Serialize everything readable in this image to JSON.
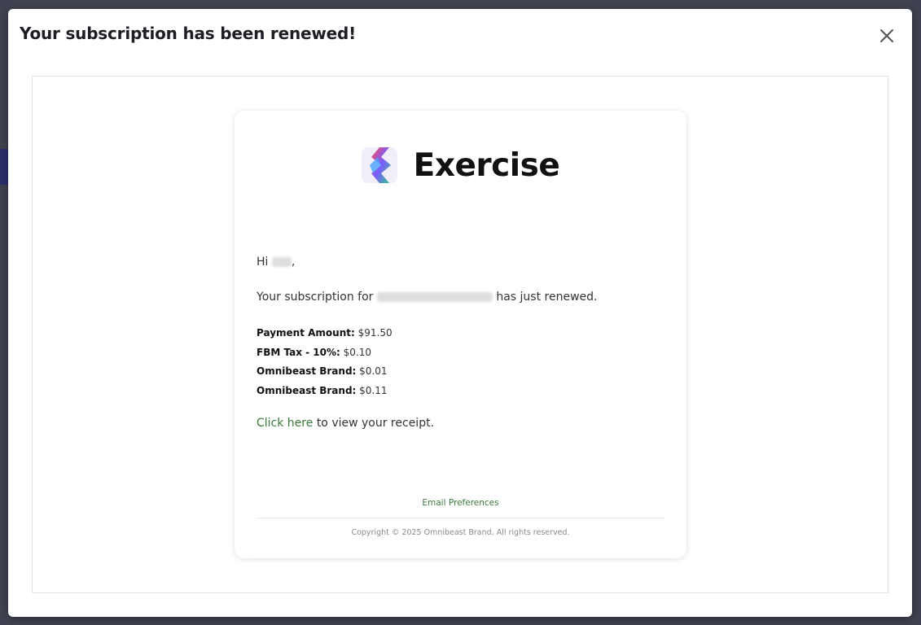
{
  "modal": {
    "title": "Your subscription has been renewed!",
    "close_icon": "close-icon"
  },
  "email": {
    "brand_name": "Exercise",
    "logo_icon": "exercise-logo-icon",
    "greeting_prefix": "Hi",
    "greeting_suffix": ",",
    "subscription_prefix": "Your subscription for",
    "subscription_suffix": "has just renewed.",
    "fees": [
      {
        "label": "Payment Amount:",
        "value": "$91.50"
      },
      {
        "label": "FBM Tax - 10%:",
        "value": "$0.10"
      },
      {
        "label": "Omnibeast Brand:",
        "value": "$0.01"
      },
      {
        "label": "Omnibeast Brand:",
        "value": "$0.11"
      }
    ],
    "receipt_link": "Click here",
    "receipt_suffix": "to view your receipt.",
    "preferences_link": "Email Preferences",
    "copyright": "Copyright © 2025 Omnibeast Brand, All rights reserved."
  },
  "colors": {
    "link": "#3b7a3b",
    "overlay": "#3f4250"
  }
}
